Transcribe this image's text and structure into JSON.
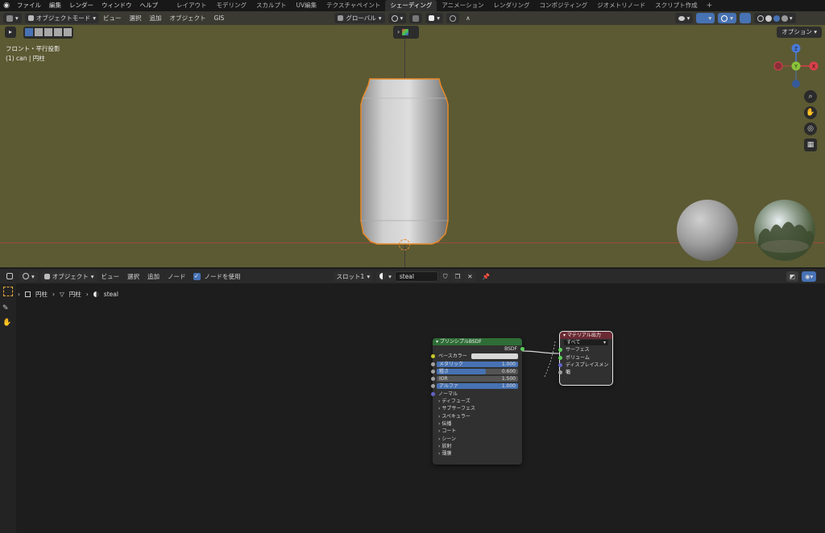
{
  "topbar": {
    "menus": [
      "ファイル",
      "編集",
      "レンダー",
      "ウィンドウ",
      "ヘルプ"
    ],
    "workspaces": [
      "レイアウト",
      "モデリング",
      "スカルプト",
      "UV編集",
      "テクスチャペイント",
      "シェーディング",
      "アニメーション",
      "レンダリング",
      "コンポジティング",
      "ジオメトリノード",
      "スクリプト作成"
    ],
    "active_workspace": "シェーディング",
    "add_symbol": "+"
  },
  "viewport": {
    "mode": "オブジェクトモード",
    "menus": [
      "ビュー",
      "選択",
      "追加",
      "オブジェクト",
      "GIS"
    ],
    "transform": "グローバル",
    "view_label": "フロント・平行投影",
    "object_label": "(1) can | 円柱",
    "options": "オプション",
    "gizmo": {
      "z": "Z",
      "y": "Y",
      "x": "X"
    }
  },
  "node_editor": {
    "type": "オブジェクト",
    "menus": [
      "ビュー",
      "選択",
      "追加",
      "ノード"
    ],
    "use_nodes_label": "ノードを使用",
    "slot": "スロット1",
    "material": "steal",
    "breadcrumb": [
      "円柱",
      "円柱",
      "steal"
    ],
    "bsdf": {
      "title": "プリンシプルBSDF",
      "output": "BSDF",
      "base_color": "ベースカラー",
      "metallic": {
        "label": "メタリック",
        "value": "1.000",
        "fraction": 1.0
      },
      "roughness": {
        "label": "粗さ",
        "value": "0.600",
        "fraction": 0.6
      },
      "ior": {
        "label": "IOR",
        "value": "1.500",
        "fraction": 0.0
      },
      "alpha": {
        "label": "アルファ",
        "value": "1.000",
        "fraction": 1.0
      },
      "normal": "ノーマル",
      "panels": [
        "ディフューズ",
        "サブサーフェス",
        "スペキュラー",
        "伝播",
        "コート",
        "シーン",
        "放射",
        "薄膜"
      ]
    },
    "output": {
      "title": "マテリアル出力",
      "target": "すべて",
      "inputs": [
        "サーフェス",
        "ボリューム",
        "ディスプレイスメント",
        "幅"
      ]
    }
  },
  "colors": {
    "viewport_bg": "#5c5a33",
    "selection_outline": "#e8892b",
    "bsdf_header": "#2f6d36",
    "output_header": "#6a2a33",
    "accent": "#4772b3"
  }
}
